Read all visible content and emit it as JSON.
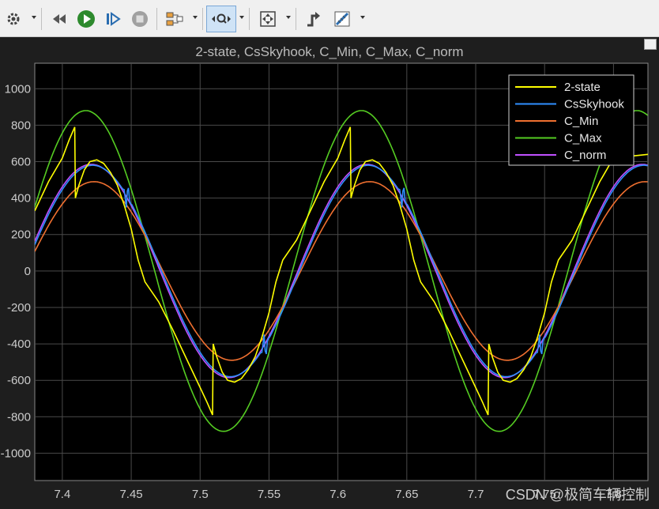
{
  "toolbar": {
    "icons": [
      "settings-icon",
      "rewind-icon",
      "run-icon",
      "step-forward-icon",
      "stop-icon",
      "signal-select-icon",
      "zoom-x-icon",
      "fit-view-icon",
      "triggers-icon",
      "measurement-icon"
    ]
  },
  "watermark": "CSDN @极简车辆控制",
  "chart_data": {
    "type": "line",
    "title": "2-state, CsSkyhook, C_Min, C_Max, C_norm",
    "xlim": [
      7.38,
      7.825
    ],
    "ylim": [
      -1150,
      1140
    ],
    "xticks": [
      "7.4",
      "7.45",
      "7.5",
      "7.55",
      "7.6",
      "7.65",
      "7.7",
      "7.75",
      "7.8"
    ],
    "yticks": [
      "1000",
      "800",
      "600",
      "400",
      "200",
      "0",
      "-200",
      "-400",
      "-600",
      "-800",
      "-1000"
    ],
    "grid": true,
    "legend_position": "top-right",
    "period": 0.2,
    "colors": {
      "background": "#000000",
      "grid": "#4a4a4a",
      "axis_text": "#cccccc",
      "title": "#bbbbbb"
    },
    "series": [
      {
        "name": "2-state",
        "color": "#ffff00",
        "values": [
          {
            "x": 7.38,
            "y": 330
          },
          {
            "x": 7.39,
            "y": 490
          },
          {
            "x": 7.4,
            "y": 620
          },
          {
            "x": 7.405,
            "y": 720
          },
          {
            "x": 7.409,
            "y": 790
          },
          {
            "x": 7.4095,
            "y": 400
          },
          {
            "x": 7.412,
            "y": 470
          },
          {
            "x": 7.416,
            "y": 555
          },
          {
            "x": 7.42,
            "y": 600
          },
          {
            "x": 7.425,
            "y": 610
          },
          {
            "x": 7.43,
            "y": 590
          },
          {
            "x": 7.435,
            "y": 540
          },
          {
            "x": 7.44,
            "y": 470
          },
          {
            "x": 7.445,
            "y": 360
          },
          {
            "x": 7.45,
            "y": 230
          },
          {
            "x": 7.455,
            "y": 60
          },
          {
            "x": 7.46,
            "y": -60
          },
          {
            "x": 7.47,
            "y": -170
          },
          {
            "x": 7.48,
            "y": -320
          },
          {
            "x": 7.49,
            "y": -480
          },
          {
            "x": 7.5,
            "y": -640
          },
          {
            "x": 7.505,
            "y": -720
          },
          {
            "x": 7.509,
            "y": -790
          },
          {
            "x": 7.5095,
            "y": -400
          },
          {
            "x": 7.512,
            "y": -470
          },
          {
            "x": 7.516,
            "y": -555
          },
          {
            "x": 7.52,
            "y": -600
          },
          {
            "x": 7.525,
            "y": -610
          },
          {
            "x": 7.53,
            "y": -590
          },
          {
            "x": 7.535,
            "y": -540
          },
          {
            "x": 7.54,
            "y": -470
          },
          {
            "x": 7.545,
            "y": -360
          },
          {
            "x": 7.55,
            "y": -230
          },
          {
            "x": 7.555,
            "y": -60
          },
          {
            "x": 7.56,
            "y": 60
          },
          {
            "x": 7.57,
            "y": 170
          },
          {
            "x": 7.58,
            "y": 330
          },
          {
            "x": 7.59,
            "y": 490
          },
          {
            "x": 7.6,
            "y": 620
          },
          {
            "x": 7.605,
            "y": 720
          },
          {
            "x": 7.609,
            "y": 790
          },
          {
            "x": 7.6095,
            "y": 400
          },
          {
            "x": 7.612,
            "y": 470
          },
          {
            "x": 7.616,
            "y": 555
          },
          {
            "x": 7.62,
            "y": 600
          },
          {
            "x": 7.625,
            "y": 610
          },
          {
            "x": 7.63,
            "y": 590
          },
          {
            "x": 7.635,
            "y": 540
          },
          {
            "x": 7.64,
            "y": 470
          },
          {
            "x": 7.645,
            "y": 360
          },
          {
            "x": 7.65,
            "y": 230
          },
          {
            "x": 7.655,
            "y": 60
          },
          {
            "x": 7.66,
            "y": -60
          },
          {
            "x": 7.67,
            "y": -170
          },
          {
            "x": 7.68,
            "y": -320
          },
          {
            "x": 7.69,
            "y": -480
          },
          {
            "x": 7.7,
            "y": -640
          },
          {
            "x": 7.705,
            "y": -720
          },
          {
            "x": 7.709,
            "y": -790
          },
          {
            "x": 7.7095,
            "y": -400
          },
          {
            "x": 7.712,
            "y": -470
          },
          {
            "x": 7.716,
            "y": -555
          },
          {
            "x": 7.72,
            "y": -600
          },
          {
            "x": 7.725,
            "y": -610
          },
          {
            "x": 7.73,
            "y": -590
          },
          {
            "x": 7.735,
            "y": -540
          },
          {
            "x": 7.74,
            "y": -470
          },
          {
            "x": 7.745,
            "y": -360
          },
          {
            "x": 7.75,
            "y": -230
          },
          {
            "x": 7.755,
            "y": -60
          },
          {
            "x": 7.76,
            "y": 60
          },
          {
            "x": 7.77,
            "y": 170
          },
          {
            "x": 7.78,
            "y": 330
          },
          {
            "x": 7.79,
            "y": 490
          },
          {
            "x": 7.8,
            "y": 620
          },
          {
            "x": 7.825,
            "y": 640
          }
        ]
      },
      {
        "name": "CsSkyhook",
        "color": "#2f8fff",
        "amplitude": 580,
        "phase_x": 7.372,
        "spikes": [
          7.447,
          7.547,
          7.647,
          7.747
        ],
        "spike_amp": 90
      },
      {
        "name": "C_Min",
        "color": "#f07030",
        "amplitude": 490,
        "phase_x": 7.373
      },
      {
        "name": "C_Max",
        "color": "#55cc22",
        "amplitude": 880,
        "phase_x": 7.367
      },
      {
        "name": "C_norm",
        "color": "#c050ff",
        "amplitude": 585,
        "phase_x": 7.371
      }
    ]
  }
}
